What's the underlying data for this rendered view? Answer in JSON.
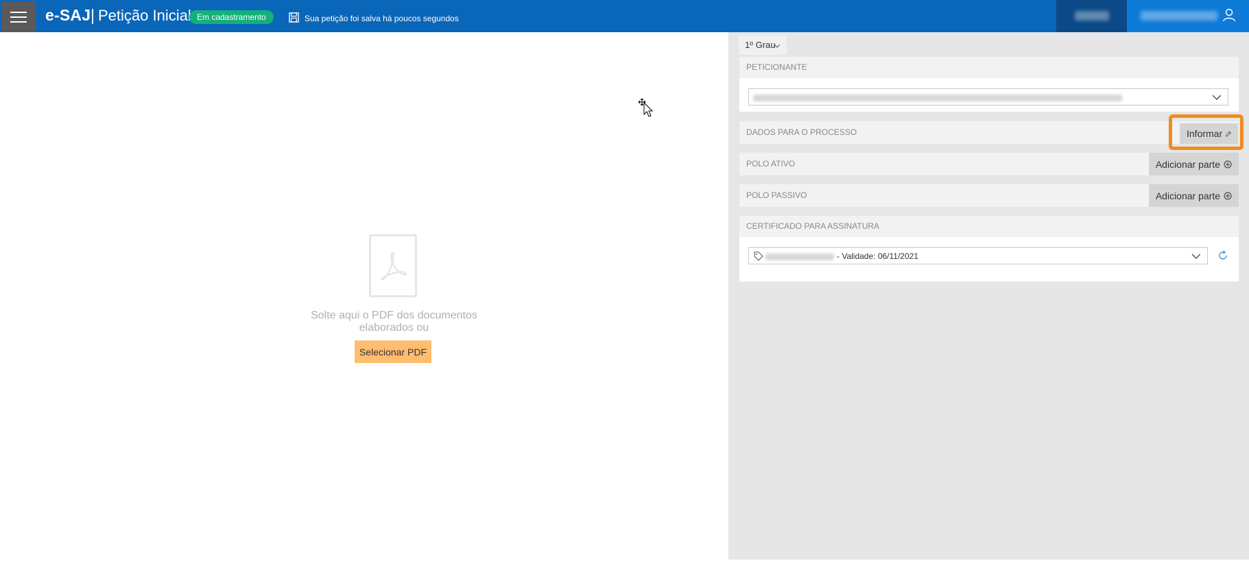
{
  "header": {
    "brand": "e-SAJ",
    "separator": "|",
    "title": "Petição Inicial",
    "status_badge": "Em cadastramento",
    "save_status": "Sua petição foi salva há poucos segundos",
    "menu_icon": "hamburger-menu-icon",
    "user_icon": "user-icon",
    "colors": {
      "bar": "#0a66b8",
      "badge": "#13b07a"
    }
  },
  "drop_area": {
    "icon": "pdf-file-icon",
    "text": "Solte aqui o PDF dos documentos elaborados ou",
    "select_button": "Selecionar PDF",
    "button_color": "#ffbe6f"
  },
  "right_panel": {
    "grau_tab": "1º Grau",
    "peticionante": {
      "header": "PETICIONANTE"
    },
    "dados_processo": {
      "label": "DADOS PARA O PROCESSO",
      "button": "Informar"
    },
    "polo_ativo": {
      "label": "POLO ATIVO",
      "button": "Adicionar parte"
    },
    "polo_passivo": {
      "label": "POLO PASSIVO",
      "button": "Adicionar parte"
    },
    "certificado": {
      "header": "CERTIFICADO PARA ASSINATURA",
      "selected_text": "- Validade: 06/11/2021"
    },
    "highlight_color": "#f08c1e"
  }
}
